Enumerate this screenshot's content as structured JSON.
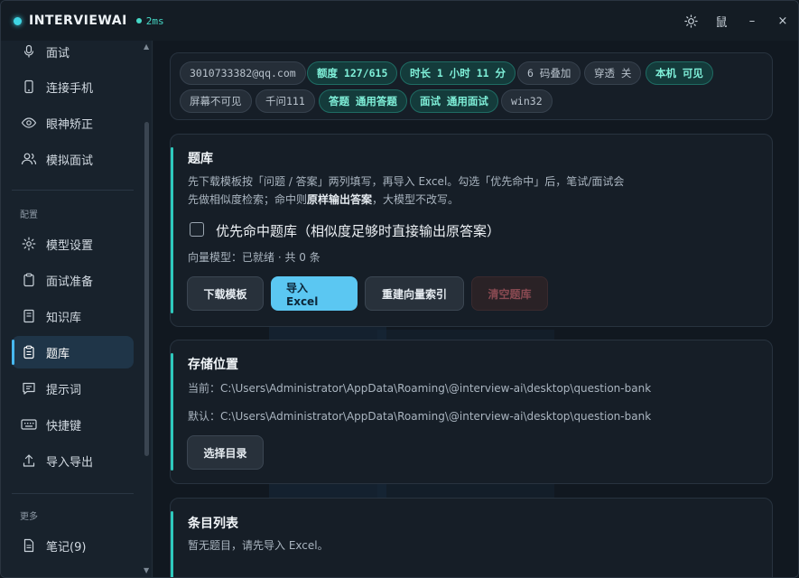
{
  "app": {
    "title": "INTERVIEWAI",
    "latency": "2ms"
  },
  "titlebar": {
    "lang_label": "鼠",
    "minimize": "–",
    "close": "×"
  },
  "sidebar": {
    "top_items": [
      {
        "label": "面试",
        "icon": "mic-icon"
      },
      {
        "label": "连接手机",
        "icon": "phone-icon"
      },
      {
        "label": "眼神矫正",
        "icon": "eye-icon"
      },
      {
        "label": "模拟面试",
        "icon": "users-icon"
      }
    ],
    "config_label": "配置",
    "config_items": [
      {
        "label": "模型设置",
        "icon": "gear-icon"
      },
      {
        "label": "面试准备",
        "icon": "clipboard-icon"
      },
      {
        "label": "知识库",
        "icon": "book-icon"
      },
      {
        "label": "题库",
        "icon": "clipboard-list-icon",
        "active": true
      },
      {
        "label": "提示词",
        "icon": "message-icon"
      },
      {
        "label": "快捷键",
        "icon": "keyboard-icon"
      },
      {
        "label": "导入导出",
        "icon": "upload-icon"
      }
    ],
    "more_label": "更多",
    "more_items": [
      {
        "label": "笔记(9)",
        "icon": "note-icon"
      }
    ]
  },
  "status": {
    "chips": [
      {
        "text": "3010733382@qq.com",
        "accent": false
      },
      {
        "text": "额度 127/615",
        "accent": true
      },
      {
        "text": "时长 1 小时 11 分",
        "accent": true
      },
      {
        "text": "6 码叠加",
        "accent": false
      },
      {
        "text": "穿透 关",
        "accent": false
      },
      {
        "text": "本机 可见",
        "accent": true
      },
      {
        "text": "屏幕不可见",
        "accent": false
      },
      {
        "text": "千问111",
        "accent": false
      },
      {
        "text": "答题 通用答题",
        "accent": true
      },
      {
        "text": "面试 通用面试",
        "accent": true
      },
      {
        "text": "win32",
        "accent": false
      }
    ]
  },
  "bank": {
    "title": "题库",
    "desc1": "先下载模板按「问题 / 答案」两列填写，再导入 Excel。勾选「优先命中」后，笔试/面试会",
    "desc2_a": "先做相似度检索；命中则",
    "desc2_b": "原样输出答案",
    "desc2_c": "，大模型不改写。",
    "checkbox_label": "优先命中题库（相似度足够时直接输出原答案）",
    "vector_status": "向量模型：已就绪 · 共 0 条",
    "buttons": {
      "download": "下载模板",
      "import": "导入 Excel",
      "rebuild": "重建向量索引",
      "clear": "清空题库"
    }
  },
  "storage": {
    "title": "存储位置",
    "current": "当前：C:\\Users\\Administrator\\AppData\\Roaming\\@interview-ai\\desktop\\question-bank",
    "default": "默认：C:\\Users\\Administrator\\AppData\\Roaming\\@interview-ai\\desktop\\question-bank",
    "choose": "选择目录"
  },
  "entries": {
    "title": "条目列表",
    "empty": "暂无题目，请先导入 Excel。"
  },
  "colors": {
    "accent": "#2ec9bd",
    "primary": "#5bc7f2",
    "active_nav": "#1f3548"
  }
}
